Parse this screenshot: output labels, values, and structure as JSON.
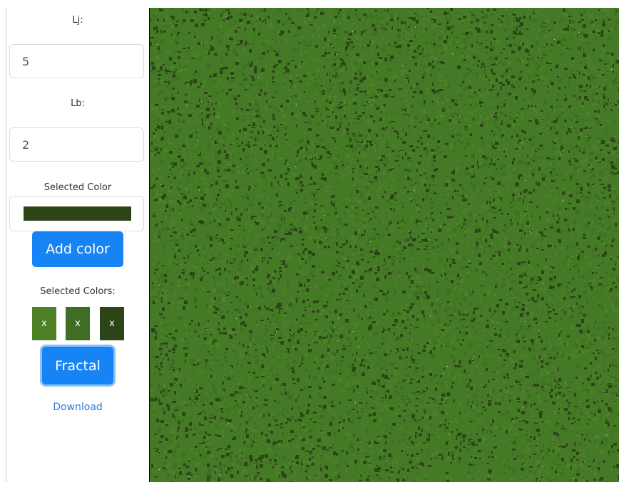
{
  "sidebar": {
    "lj_label": "Lj:",
    "lj_value": "5",
    "lb_label": "Lb:",
    "lb_value": "2",
    "selected_color_label": "Selected Color",
    "selected_color": "#2d4417",
    "add_color_label": "Add color",
    "selected_colors_label": "Selected Colors:",
    "selected_colors": [
      {
        "color": "#4e8028",
        "remove_label": "x"
      },
      {
        "color": "#3e6d23",
        "remove_label": "x"
      },
      {
        "color": "#2d4417",
        "remove_label": "x"
      }
    ],
    "fractal_label": "Fractal",
    "download_label": "Download"
  },
  "canvas": {
    "base_color": "#447a26",
    "texture_colors": [
      "#4e8028",
      "#3e6d23",
      "#2d4417"
    ]
  }
}
